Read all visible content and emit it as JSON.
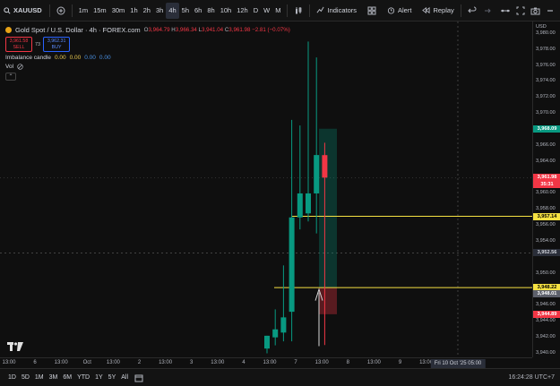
{
  "toolbar": {
    "symbol": "XAUUSD",
    "timeframes": [
      "1m",
      "15m",
      "30m",
      "1h",
      "2h",
      "3h",
      "4h",
      "5h",
      "6h",
      "8h",
      "10h",
      "12h",
      "D",
      "W",
      "M"
    ],
    "active_timeframe": "4h",
    "indicators_label": "Indicators",
    "alert_label": "Alert",
    "replay_label": "Replay"
  },
  "legend": {
    "title": "Gold Spot / U.S. Dollar · 4h · FOREX.com",
    "ohlc": [
      {
        "k": "O",
        "v": "3,964.79"
      },
      {
        "k": "H",
        "v": "3,966.34"
      },
      {
        "k": "L",
        "v": "3,941.04"
      },
      {
        "k": "C",
        "v": "3,961.98"
      },
      {
        "k": "",
        "v": "−2.81 (−0.07%)"
      }
    ],
    "sell_price": "3,961.58",
    "sell_label": "SELL",
    "spread": "73",
    "buy_price": "3,962.31",
    "buy_label": "BUY",
    "indicator_name": "Imbalance candle",
    "indicator_values": [
      "0.00",
      "0.00",
      "0.00",
      "0.00"
    ],
    "volume_label": "Vol"
  },
  "price_axis": {
    "currency": "USD",
    "ticks": [
      "3,980.00",
      "3,978.00",
      "3,976.00",
      "3,974.00",
      "3,972.00",
      "3,970.00",
      "3,966.00",
      "3,964.00",
      "3,962.00",
      "3,960.00",
      "3,958.00",
      "3,956.00",
      "3,954.00",
      "3,950.00",
      "3,946.00",
      "3,944.00",
      "3,942.00",
      "3,940.00"
    ],
    "tick_values": [
      3980,
      3978,
      3976,
      3974,
      3972,
      3970,
      3966,
      3964,
      3962,
      3960,
      3958,
      3956,
      3954,
      3950,
      3946,
      3944,
      3942,
      3940
    ],
    "tags": [
      {
        "text": "3,968.09",
        "value": 3968.09,
        "bg": "#089981",
        "fg": "#ffffff"
      },
      {
        "text": "3,961.98",
        "value": 3961.98,
        "bg": "#f23645",
        "fg": "#ffffff"
      },
      {
        "text": "35:31",
        "value": 3961.1,
        "bg": "#f23645",
        "fg": "#ffffff"
      },
      {
        "text": "3,957.14",
        "value": 3957.14,
        "bg": "#f5e142",
        "fg": "#000000"
      },
      {
        "text": "3,952.56",
        "value": 3952.56,
        "bg": "#2a2e39",
        "fg": "#d1d4dc"
      },
      {
        "text": "3,948.22",
        "value": 3948.22,
        "bg": "#f5e142",
        "fg": "#000000"
      },
      {
        "text": "3,948.01",
        "value": 3947.4,
        "bg": "#5d606b",
        "fg": "#ffffff"
      },
      {
        "text": "3,944.89",
        "value": 3944.89,
        "bg": "#f23645",
        "fg": "#ffffff"
      }
    ]
  },
  "time_axis": {
    "labels": [
      "13:00",
      "6",
      "13:00",
      "Oct",
      "13:00",
      "2",
      "13:00",
      "3",
      "13:00",
      "4",
      "13:00",
      "7",
      "13:00",
      "8",
      "13:00",
      "9",
      "13:00",
      "11",
      "13:00"
    ],
    "highlight": "Fri 10 Oct '25   05:00"
  },
  "bottom": {
    "ranges": [
      "1D",
      "5D",
      "1M",
      "3M",
      "6M",
      "YTD",
      "1Y",
      "5Y",
      "All"
    ],
    "clock": "16:24:28 UTC+7"
  },
  "chart_data": {
    "type": "candlestick",
    "ylim": [
      3939.5,
      3981.5
    ],
    "candles": [
      {
        "o": 3940.6,
        "h": 3942.2,
        "l": 3940.0,
        "c": 3942.2
      },
      {
        "o": 3942.0,
        "h": 3945.5,
        "l": 3941.0,
        "c": 3943.0
      },
      {
        "o": 3942.6,
        "h": 3951.0,
        "l": 3941.5,
        "c": 3944.5
      },
      {
        "o": 3945.2,
        "h": 3969.2,
        "l": 3941.5,
        "c": 3957.0
      },
      {
        "o": 3957.0,
        "h": 3968.5,
        "l": 3955.5,
        "c": 3960.0
      },
      {
        "o": 3957.5,
        "h": 3979.0,
        "l": 3956.5,
        "c": 3960.0
      },
      {
        "o": 3960.0,
        "h": 3977.0,
        "l": 3955.0,
        "c": 3964.8
      },
      {
        "o": 3964.79,
        "h": 3966.34,
        "l": 3941.04,
        "c": 3961.98
      }
    ],
    "levels": [
      3957.14,
      3948.22
    ],
    "position": {
      "entry": 3948.22,
      "target": 3968.09,
      "stop": 3944.89
    }
  },
  "colors": {
    "up": "#089981",
    "down": "#f23645",
    "level": "#f5e142"
  }
}
